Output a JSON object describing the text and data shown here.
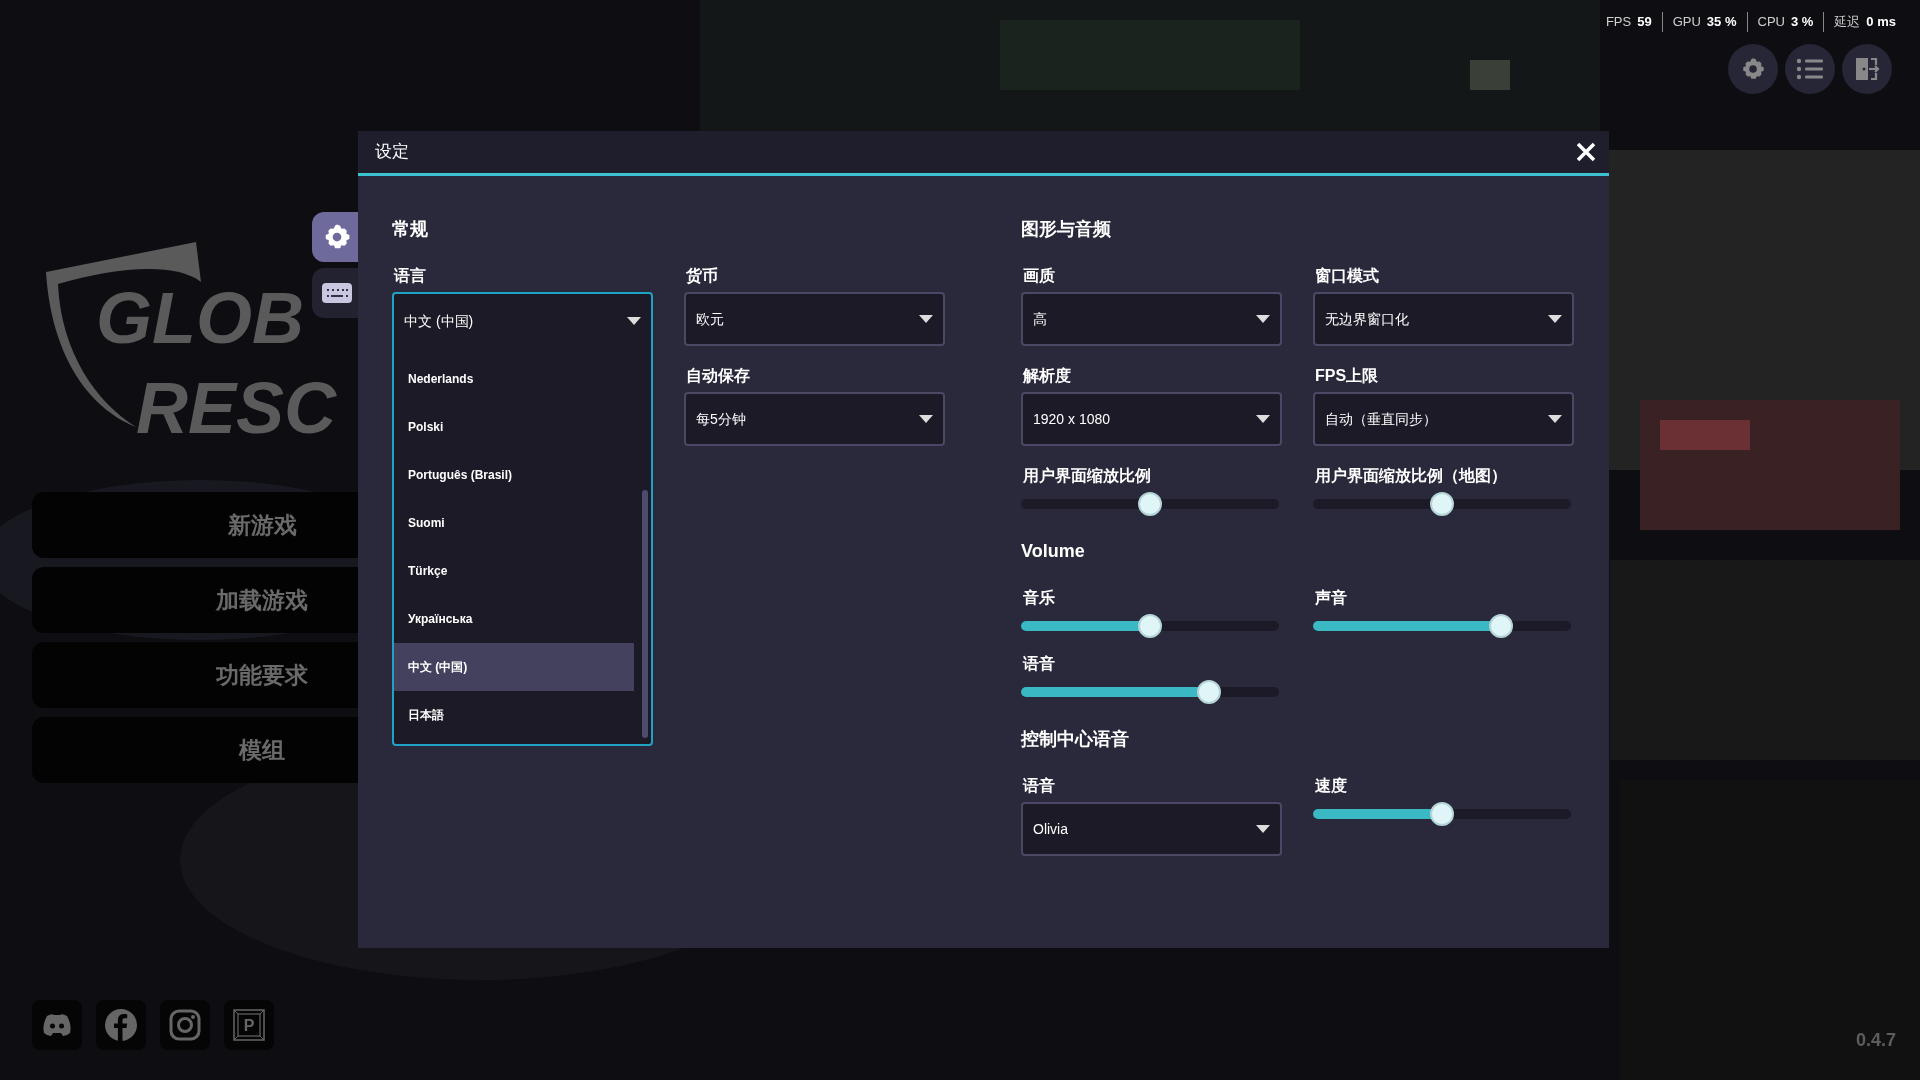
{
  "stats": [
    {
      "label": "FPS",
      "value": "59"
    },
    {
      "label": "GPU",
      "value": "35 %"
    },
    {
      "label": "CPU",
      "value": "3 %"
    },
    {
      "label": "延迟",
      "value": "0 ms"
    }
  ],
  "logo": {
    "lines": [
      "GLOB",
      "RESC"
    ]
  },
  "side_tabs": [
    {
      "kind": "settings",
      "selected": true
    },
    {
      "kind": "keyboard",
      "selected": false
    }
  ],
  "menu": [
    "新游戏",
    "加载游戏",
    "功能要求",
    "模组"
  ],
  "social_key_label": "P",
  "version": "0.4.7",
  "dialog": {
    "title": "设定",
    "general": {
      "heading": "常规",
      "language": {
        "label": "语言",
        "value": "中文 (中国)",
        "expanded": true,
        "options": [
          {
            "label": "Nederlands",
            "selected": false
          },
          {
            "label": "Polski",
            "selected": false
          },
          {
            "label": "Português (Brasil)",
            "selected": false
          },
          {
            "label": "Suomi",
            "selected": false
          },
          {
            "label": "Türkçe",
            "selected": false
          },
          {
            "label": "Українська",
            "selected": false
          },
          {
            "label": "中文 (中国)",
            "selected": true
          },
          {
            "label": "日本語",
            "selected": false
          }
        ]
      },
      "currency": {
        "label": "货币",
        "value": "欧元"
      },
      "autosave": {
        "label": "自动保存",
        "value": "每5分钟"
      }
    },
    "graphics": {
      "heading": "图形与音频",
      "selects": [
        {
          "label": "画质",
          "value": "高"
        },
        {
          "label": "窗口模式",
          "value": "无边界窗口化"
        },
        {
          "label": "解析度",
          "value": "1920 x 1080"
        },
        {
          "label": "FPS上限",
          "value": "自动（垂直同步）"
        }
      ],
      "sliders": [
        {
          "label": "用户界面缩放比例",
          "filled": false,
          "level": 0.5
        },
        {
          "label": "用户界面缩放比例（地图）",
          "filled": false,
          "level": 0.5
        }
      ]
    },
    "volume": {
      "heading": "Volume",
      "sliders": [
        {
          "label": "音乐",
          "filled": true,
          "level": 0.5
        },
        {
          "label": "声音",
          "filled": true,
          "level": 0.73
        },
        {
          "label": "语音",
          "filled": true,
          "level": 0.73
        }
      ]
    },
    "control_center": {
      "heading": "控制中心语音",
      "voice": {
        "label": "语音",
        "value": "Olivia"
      },
      "speed": {
        "label": "速度",
        "filled": true,
        "level": 0.5
      }
    }
  }
}
